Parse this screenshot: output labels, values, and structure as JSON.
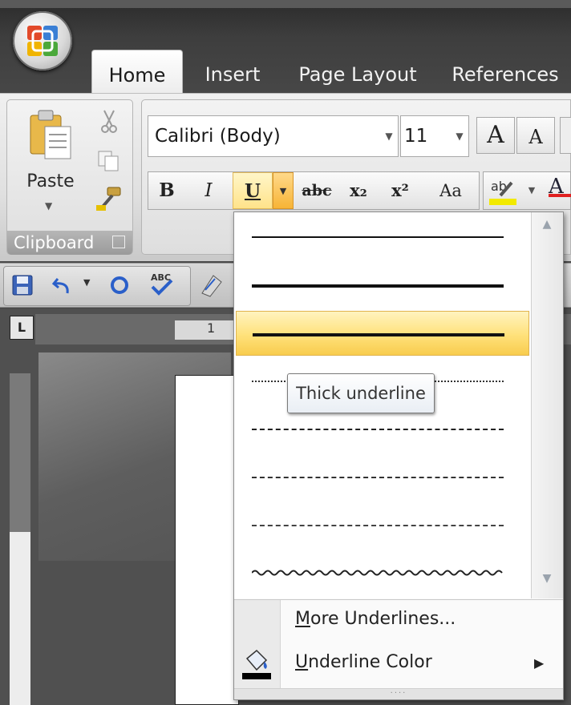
{
  "tabs": [
    "Home",
    "Insert",
    "Page Layout",
    "References"
  ],
  "clipboard": {
    "paste_label": "Paste",
    "group_label": "Clipboard"
  },
  "font": {
    "name": "Calibri (Body)",
    "size": "11",
    "grow_label": "A",
    "shrink_label": "A",
    "bold_label": "B",
    "italic_label": "I",
    "underline_label": "U",
    "strike_label": "abc",
    "subscript_label": "x₂",
    "superscript_label": "x²",
    "case_label": "Aa",
    "color_label": "A"
  },
  "ruler": {
    "number": "1",
    "tab_selector": "L"
  },
  "underline_menu": {
    "options": [
      "single",
      "thick",
      "thick-selected",
      "dotted",
      "dashed",
      "dash-dot",
      "dash-dot-dot",
      "wave"
    ],
    "selected_index": 2,
    "tooltip": "Thick underline",
    "more_label_mnemonic": "M",
    "more_label_rest": "ore Underlines...",
    "color_label_mnemonic": "U",
    "color_label_rest": "nderline Color"
  },
  "colors": {
    "highlight": "#ffd84a",
    "underline_button_active": "#f7b436",
    "font_color_bar": "#e02020",
    "highlight_bar": "#f2ea00"
  },
  "icons": {
    "office": "office-logo-icon",
    "paste": "clipboard-paste-icon",
    "cut": "scissors-icon",
    "copy": "copy-icon",
    "format_painter": "paintbrush-icon",
    "save": "floppy-disk-icon",
    "undo": "undo-icon",
    "redo": "redo-icon",
    "spelling": "spell-check-icon",
    "underline_color": "paint-bucket-icon"
  }
}
